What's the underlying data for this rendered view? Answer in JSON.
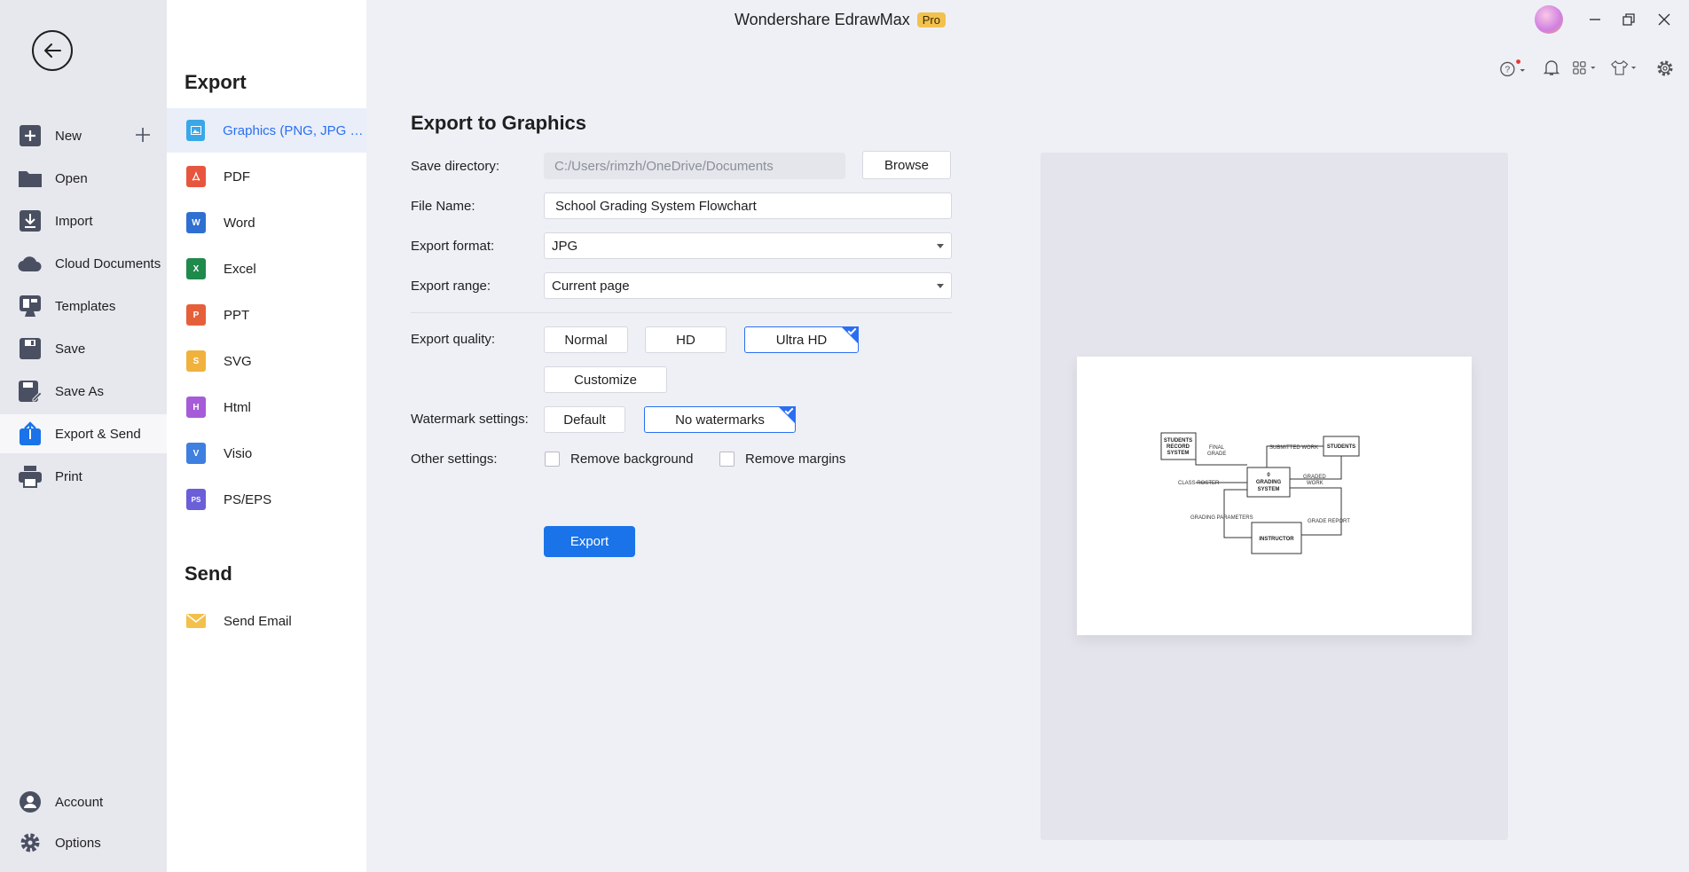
{
  "app": {
    "title": "Wondershare EdrawMax",
    "badge": "Pro"
  },
  "left_nav": {
    "items": [
      {
        "label": "New",
        "icon": "plus-square-icon"
      },
      {
        "label": "Open",
        "icon": "folder-icon"
      },
      {
        "label": "Import",
        "icon": "import-icon"
      },
      {
        "label": "Cloud Documents",
        "icon": "cloud-icon"
      },
      {
        "label": "Templates",
        "icon": "templates-icon"
      },
      {
        "label": "Save",
        "icon": "save-icon"
      },
      {
        "label": "Save As",
        "icon": "save-as-icon"
      },
      {
        "label": "Export & Send",
        "icon": "export-icon",
        "active": true
      },
      {
        "label": "Print",
        "icon": "print-icon"
      }
    ],
    "bottom": [
      {
        "label": "Account",
        "icon": "account-icon"
      },
      {
        "label": "Options",
        "icon": "gear-icon"
      }
    ]
  },
  "sub_panel": {
    "export_heading": "Export",
    "formats": [
      {
        "label": "Graphics (PNG, JPG et...",
        "color": "#3aa7e8",
        "letter": "",
        "active": true
      },
      {
        "label": "PDF",
        "color": "#e8553f",
        "letter": ""
      },
      {
        "label": "Word",
        "color": "#2f6fd1",
        "letter": "W"
      },
      {
        "label": "Excel",
        "color": "#1f8a4c",
        "letter": "X"
      },
      {
        "label": "PPT",
        "color": "#e5603a",
        "letter": "P"
      },
      {
        "label": "SVG",
        "color": "#f0b23d",
        "letter": "S"
      },
      {
        "label": "Html",
        "color": "#a65cd9",
        "letter": "H"
      },
      {
        "label": "Visio",
        "color": "#3f7fe0",
        "letter": "V"
      },
      {
        "label": "PS/EPS",
        "color": "#6a5ed9",
        "letter": "PS"
      }
    ],
    "send_heading": "Send",
    "send_items": [
      {
        "label": "Send Email",
        "color": "#f3c04b"
      }
    ]
  },
  "form": {
    "title": "Export to Graphics",
    "save_directory": {
      "label": "Save directory:",
      "value": "C:/Users/rimzh/OneDrive/Documents",
      "browse": "Browse"
    },
    "file_name": {
      "label": "File Name:",
      "value": "School Grading System Flowchart"
    },
    "export_format": {
      "label": "Export format:",
      "value": "JPG"
    },
    "export_range": {
      "label": "Export range:",
      "value": "Current page"
    },
    "export_quality": {
      "label": "Export quality:",
      "options": [
        "Normal",
        "HD",
        "Ultra HD"
      ],
      "selected": "Ultra HD",
      "customize": "Customize"
    },
    "watermark": {
      "label": "Watermark settings:",
      "options": [
        "Default",
        "No watermarks"
      ],
      "selected": "No watermarks"
    },
    "other": {
      "label": "Other settings:",
      "remove_background": "Remove background",
      "remove_margins": "Remove margins"
    },
    "export_button": "Export"
  },
  "preview": {
    "nodes": {
      "records": [
        "STUDENTS",
        "RECORD",
        "SYSTEM"
      ],
      "students": "STUDENTS",
      "grading": [
        "0",
        "GRADING",
        "SYSTEM"
      ],
      "instructor": "INSTRUCTOR"
    },
    "labels": {
      "final_grade": [
        "FINAL",
        "GRADE"
      ],
      "submitted_work": "SUBMITTED WORK",
      "graded_work": [
        "GRADED",
        "WORK"
      ],
      "class_roster": "CLASS ROSTER",
      "grading_parameters": "GRADING PARAMETERS",
      "grade_report": "GRADE REPORT"
    }
  }
}
